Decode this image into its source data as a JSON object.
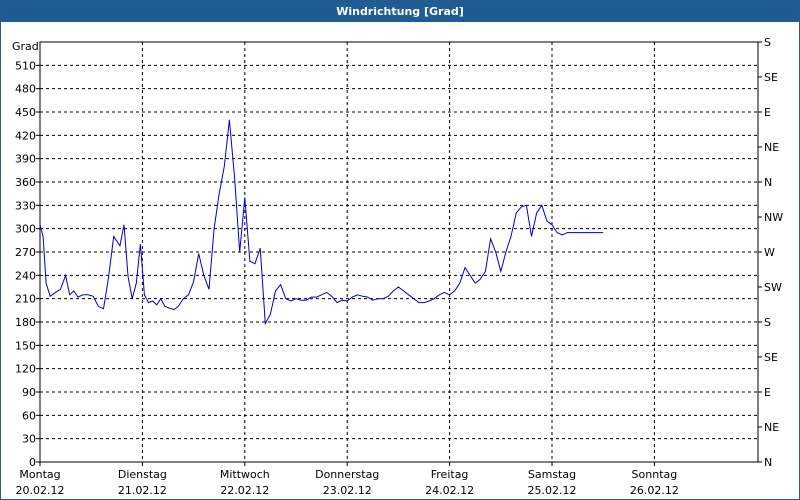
{
  "window": {
    "title": "Windrichtung [Grad]"
  },
  "chart_data": {
    "type": "line",
    "title": "Windrichtung [Grad]",
    "ylabel": "Grad",
    "ylim": [
      0,
      540
    ],
    "y_ticks": [
      0,
      30,
      60,
      90,
      120,
      150,
      180,
      210,
      240,
      270,
      300,
      330,
      360,
      390,
      420,
      450,
      480,
      510
    ],
    "right_axis_labels": [
      "N",
      "NE",
      "E",
      "SE",
      "S",
      "SW",
      "W",
      "NW",
      "N",
      "NE",
      "E",
      "SE",
      "S"
    ],
    "x_categories": [
      {
        "day": "Montag",
        "date": "20.02.12"
      },
      {
        "day": "Dienstag",
        "date": "21.02.12"
      },
      {
        "day": "Mittwoch",
        "date": "22.02.12"
      },
      {
        "day": "Donnerstag",
        "date": "23.02.12"
      },
      {
        "day": "Freitag",
        "date": "24.02.12"
      },
      {
        "day": "Samstag",
        "date": "25.02.12"
      },
      {
        "day": "Sonntag",
        "date": "26.02.12"
      }
    ],
    "xlim": [
      0,
      7
    ],
    "grid": true,
    "series": [
      {
        "color": "#0000cc",
        "x": [
          0.0,
          0.03,
          0.06,
          0.1,
          0.15,
          0.2,
          0.25,
          0.29,
          0.33,
          0.37,
          0.42,
          0.47,
          0.52,
          0.57,
          0.62,
          0.67,
          0.72,
          0.78,
          0.82,
          0.86,
          0.9,
          0.94,
          0.98,
          1.02,
          1.06,
          1.1,
          1.14,
          1.18,
          1.22,
          1.26,
          1.31,
          1.35,
          1.4,
          1.45,
          1.5,
          1.55,
          1.6,
          1.65,
          1.7,
          1.75,
          1.8,
          1.85,
          1.9,
          1.95,
          2.0,
          2.05,
          2.1,
          2.15,
          2.2,
          2.25,
          2.3,
          2.35,
          2.4,
          2.45,
          2.5,
          2.55,
          2.6,
          2.65,
          2.7,
          2.75,
          2.8,
          2.85,
          2.9,
          2.95,
          3.0,
          3.05,
          3.1,
          3.15,
          3.2,
          3.25,
          3.3,
          3.35,
          3.4,
          3.45,
          3.5,
          3.55,
          3.6,
          3.65,
          3.7,
          3.75,
          3.8,
          3.85,
          3.9,
          3.95,
          4.0,
          4.05,
          4.1,
          4.15,
          4.2,
          4.25,
          4.3,
          4.35,
          4.4,
          4.45,
          4.5,
          4.55,
          4.6,
          4.65,
          4.7,
          4.75,
          4.8,
          4.85,
          4.9,
          4.95,
          5.0,
          5.05,
          5.1,
          5.15,
          5.2,
          5.25,
          5.3,
          5.35,
          5.4,
          5.45,
          5.5
        ],
        "values": [
          305,
          290,
          230,
          213,
          218,
          222,
          240,
          215,
          220,
          212,
          215,
          215,
          213,
          200,
          197,
          238,
          290,
          278,
          305,
          238,
          210,
          230,
          280,
          215,
          205,
          207,
          202,
          210,
          200,
          198,
          196,
          200,
          210,
          215,
          232,
          268,
          240,
          222,
          300,
          345,
          380,
          440,
          365,
          270,
          340,
          258,
          255,
          275,
          178,
          190,
          220,
          228,
          210,
          207,
          210,
          208,
          208,
          212,
          212,
          215,
          218,
          213,
          205,
          208,
          207,
          212,
          215,
          213,
          212,
          208,
          210,
          210,
          213,
          220,
          225,
          220,
          215,
          210,
          205,
          205,
          207,
          210,
          215,
          218,
          215,
          220,
          230,
          250,
          240,
          230,
          235,
          245,
          287,
          270,
          245,
          270,
          290,
          320,
          328,
          330,
          290,
          320,
          330,
          310,
          305,
          295,
          292,
          295,
          295,
          295,
          295,
          295,
          295,
          295,
          295
        ]
      }
    ]
  }
}
